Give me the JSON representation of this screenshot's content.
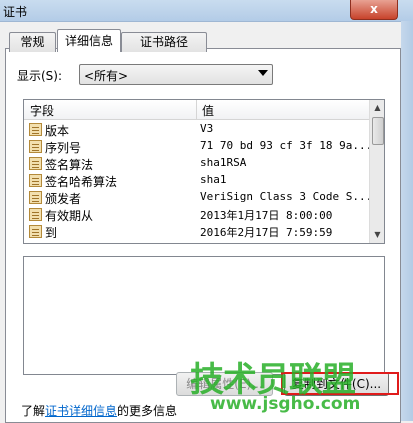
{
  "window": {
    "title": "证书",
    "close_symbol": "x"
  },
  "tabs": [
    {
      "label": "常规",
      "active": false
    },
    {
      "label": "详细信息",
      "active": true
    },
    {
      "label": "证书路径",
      "active": false
    }
  ],
  "show": {
    "label": "显示(S):",
    "value": "<所有>"
  },
  "list": {
    "columns": [
      "字段",
      "值"
    ],
    "rows": [
      {
        "field": "版本",
        "value": "V3"
      },
      {
        "field": "序列号",
        "value": "71 70 bd 93 cf 3f 18 9a..."
      },
      {
        "field": "签名算法",
        "value": "sha1RSA"
      },
      {
        "field": "签名哈希算法",
        "value": "sha1"
      },
      {
        "field": "颁发者",
        "value": "VeriSign Class 3 Code S..."
      },
      {
        "field": "有效期从",
        "value": "2013年1月17日 8:00:00"
      },
      {
        "field": "到",
        "value": "2016年2月17日 7:59:59"
      }
    ]
  },
  "buttons": {
    "edit_label": "编辑属性(E)...",
    "copy_label": "复制到文件(C)..."
  },
  "footer": {
    "prefix": "了解",
    "link": "证书详细信息",
    "suffix": "的更多信息"
  },
  "watermark": {
    "main": "技术员联盟",
    "url": "www.jsgho.com"
  },
  "colors": {
    "link": "#0066cc",
    "highlight": "#e01b1b",
    "watermark": "#28af28"
  }
}
